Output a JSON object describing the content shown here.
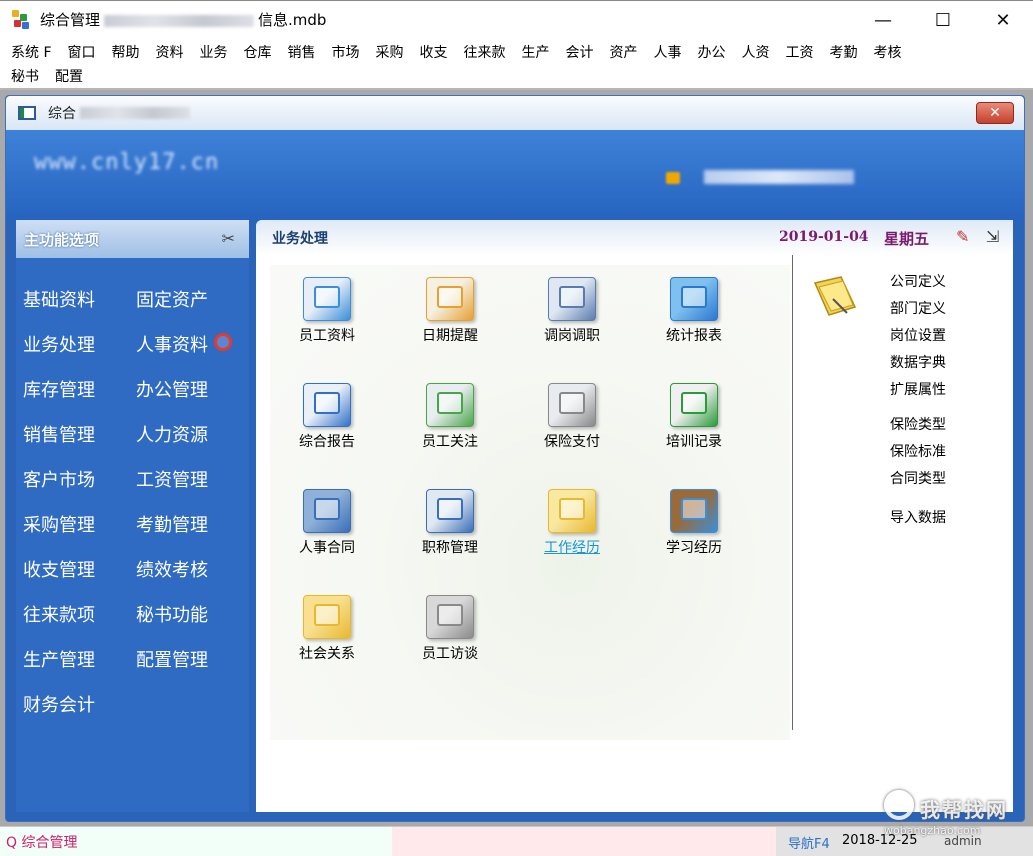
{
  "window": {
    "title_prefix": "综合管理",
    "title_suffix": "信息.mdb",
    "minimize": "—",
    "maximize": "☐",
    "close": "✕"
  },
  "menu": {
    "row1": [
      "系统 F",
      "窗口",
      "帮助",
      "资料",
      "业务",
      "仓库",
      "销售",
      "市场",
      "采购",
      "收支",
      "往来款",
      "生产",
      "会计",
      "资产",
      "人事",
      "办公",
      "人资",
      "工资",
      "考勤",
      "考核"
    ],
    "row2": [
      "秘书",
      "配置"
    ]
  },
  "child": {
    "title": "综合",
    "close": "✕"
  },
  "banner": {
    "url": "www.cnly17.cn"
  },
  "nav": {
    "header": "主功能选项",
    "items": [
      "基础资料",
      "固定资产",
      "业务处理",
      "人事资料",
      "库存管理",
      "办公管理",
      "销售管理",
      "人力资源",
      "客户市场",
      "工资管理",
      "采购管理",
      "考勤管理",
      "收支管理",
      "绩效考核",
      "往来款项",
      "秘书功能",
      "生产管理",
      "配置管理",
      "财务会计"
    ]
  },
  "panel": {
    "title": "业务处理",
    "date": "2019-01-04",
    "weekday": "星期五",
    "tiles": [
      {
        "label": "员工资料",
        "color": "#3a8fd8",
        "accent": "#e8eef8"
      },
      {
        "label": "日期提醒",
        "color": "#e6a033",
        "accent": "#f5f0e0"
      },
      {
        "label": "调岗调职",
        "color": "#5b7bb0",
        "accent": "#dfe8f2"
      },
      {
        "label": "统计报表",
        "color": "#2b78d0",
        "accent": "#7fc0ee"
      },
      {
        "label": "综合报告",
        "color": "#3170c8",
        "accent": "#eaf0f8"
      },
      {
        "label": "员工关注",
        "color": "#4aa44a",
        "accent": "#e8eef0"
      },
      {
        "label": "保险支付",
        "color": "#888888",
        "accent": "#e8ecf0"
      },
      {
        "label": "培训记录",
        "color": "#2a9a3a",
        "accent": "#f0f0f0"
      },
      {
        "label": "人事合同",
        "color": "#3a6fb8",
        "accent": "#8fb0d8"
      },
      {
        "label": "职称管理",
        "color": "#3a6fb8",
        "accent": "#e0e8f2"
      },
      {
        "label": "工作经历",
        "color": "#e8b830",
        "accent": "#f8e8a0"
      },
      {
        "label": "学习经历",
        "color": "#3a8fd8",
        "accent": "#9a6a3a"
      },
      {
        "label": "社会关系",
        "color": "#e8b830",
        "accent": "#f8e090"
      },
      {
        "label": "员工访谈",
        "color": "#8a8a8a",
        "accent": "#d8d8d8"
      }
    ],
    "side_items": [
      "公司定义",
      "部门定义",
      "岗位设置",
      "数据字典",
      "扩展属性",
      "保险类型",
      "保险标准",
      "合同类型",
      "导入数据"
    ]
  },
  "status": {
    "left": "Q 综合管理",
    "nav": "导航F4",
    "date": "2018-12-25",
    "user": "admin"
  },
  "watermark": {
    "text": "我帮找网",
    "sub": "wobangzhao.com"
  }
}
